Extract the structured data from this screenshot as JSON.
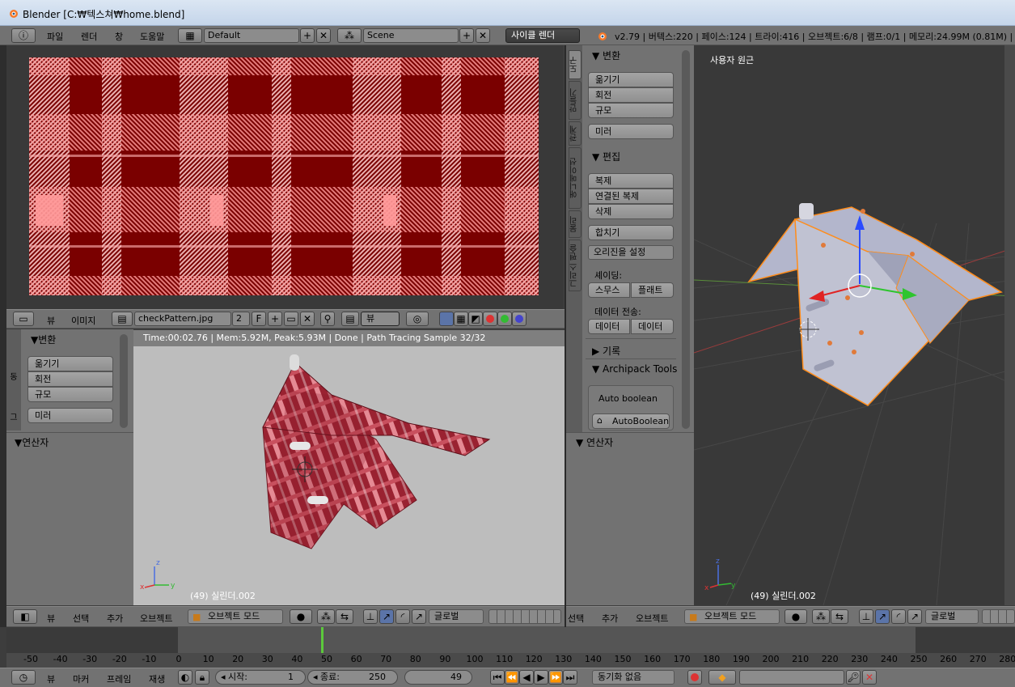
{
  "titlebar": {
    "title": "Blender [C:₩텍스쳐₩home.blend]"
  },
  "menu": {
    "items": [
      "파일",
      "렌더",
      "창",
      "도움말"
    ],
    "layout": "Default",
    "scene": "Scene",
    "engine": "사이클 렌더",
    "stats": "v2.79 | 버텍스:220 | 페이스:124 | 트라이:416 | 오브젝트:6/8 | 램프:0/1 | 메모리:24.99M (0.81M) | 실"
  },
  "image_editor": {
    "header_view": "뷰",
    "header_image": "이미지",
    "image_name": "checkPattern.jpg",
    "image_users": "2",
    "fake_user": "F",
    "display_mode": "뷰"
  },
  "left_tools": {
    "transform_title": "▼변환",
    "buttons": [
      "옮기기",
      "회전",
      "규모",
      "미러"
    ],
    "operator_title": "▼연산자",
    "tabs": [
      "동",
      "그"
    ]
  },
  "render_view": {
    "status": "Time:00:02.76 | Mem:5.92M, Peak:5.93M | Done | Path Tracing Sample 32/32",
    "object_label": "(49) 실린더.002"
  },
  "tool_shelf": {
    "tabs": [
      "도구",
      "만들기",
      "관계",
      "애니메이션",
      "물리",
      "그리스 펜슬"
    ],
    "transform_title": "▼ 변환",
    "transform_buttons": [
      "옮기기",
      "회전",
      "규모"
    ],
    "mirror": "미러",
    "edit_title": "▼ 편집",
    "edit_buttons": [
      "복제",
      "연결된 복제",
      "삭제"
    ],
    "join": "합치기",
    "set_origin": "오리진을 설정",
    "shading_label": "셰이딩:",
    "smooth": "스무스",
    "flat": "플래트",
    "data_transfer_label": "데이터 전송:",
    "data1": "데이터",
    "data2": "데이터",
    "history_title": "▶ 기록",
    "archipack_title": "▼ Archipack Tools",
    "auto_boolean_label": "Auto boolean",
    "auto_boolean_button": "AutoBoolean",
    "operator_title": "▼ 연산자"
  },
  "viewport": {
    "view_label": "사용자 원근",
    "object_label": "(49) 실린더.002"
  },
  "view_headers": {
    "left": {
      "view": "뷰",
      "select": "선택",
      "add": "추가",
      "object": "오브젝트",
      "mode": "오브젝트 모드",
      "orientation": "글로벌"
    },
    "right": {
      "select": "선택",
      "add": "추가",
      "object": "오브젝트",
      "mode": "오브젝트 모드",
      "orientation": "글로벌"
    }
  },
  "timeline": {
    "ticks": [
      "-50",
      "-40",
      "-30",
      "-20",
      "-10",
      "0",
      "10",
      "20",
      "30",
      "40",
      "50",
      "60",
      "70",
      "80",
      "90",
      "100",
      "110",
      "120",
      "130",
      "140",
      "150",
      "160",
      "170",
      "180",
      "190",
      "200",
      "210",
      "220",
      "230",
      "240",
      "250",
      "260",
      "270",
      "280"
    ],
    "current_frame_value": 49
  },
  "timeline_header": {
    "view": "뷰",
    "marker": "마커",
    "frame": "프레임",
    "playback": "재생",
    "start_label": "◂ 시작:",
    "start_value": "1",
    "end_label": "◂ 종료:",
    "end_value": "250",
    "current": "49",
    "sync": "동기화 없음"
  },
  "colors": {
    "plaid_dark": "#6a0000",
    "plaid_mid": "#b5222a",
    "plaid_light": "#ff8c8c",
    "selected_outline": "#ff8c1a",
    "frame_marker": "#5cc83c"
  }
}
